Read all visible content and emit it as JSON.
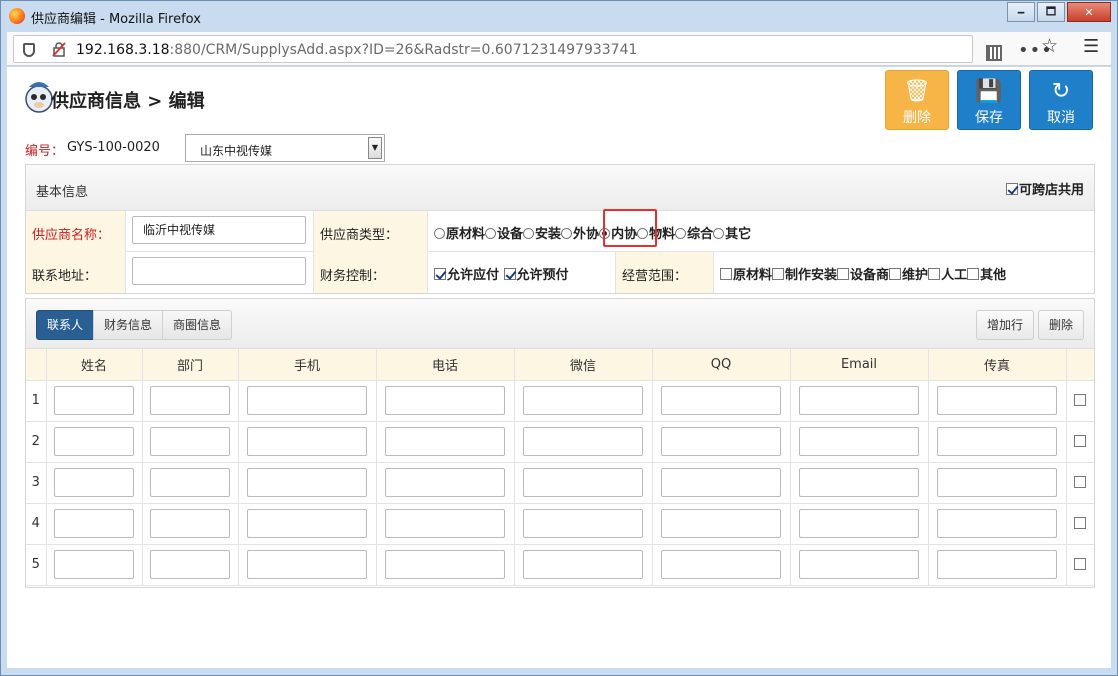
{
  "window": {
    "title": "供应商编辑 - Mozilla Firefox",
    "minimize_label": "🗕",
    "maximize_label": "🗖",
    "close_label": "✕"
  },
  "browser": {
    "url_host": "192.168.3.18",
    "url_rest": ":880/CRM/SupplysAdd.aspx?ID=26&Radstr=0.6071231497933741"
  },
  "page": {
    "title": "供应商信息 > 编辑",
    "actions": {
      "delete": "删除",
      "save": "保存",
      "cancel": "取消"
    },
    "code_label": "编号：",
    "code_value": "GYS-100-0020",
    "company_select": "山东中视传媒"
  },
  "basic_info": {
    "title": "基本信息",
    "cross_share_label": "可跨店共用",
    "cross_share_checked": true,
    "supplier_name_label": "供应商名称：",
    "supplier_name_value": "临沂中视传媒",
    "supplier_type_label": "供应商类型：",
    "supplier_types": [
      "原材料",
      "设备",
      "安装",
      "外协",
      "内协",
      "物料",
      "综合",
      "其它"
    ],
    "supplier_type_selected": "内协",
    "address_label": "联系地址：",
    "address_value": "",
    "finance_label": "财务控制：",
    "finance_options": [
      "允许应付",
      "允许预付"
    ],
    "scope_label": "经营范围：",
    "scope_options": [
      "原材料",
      "制作安装",
      "设备商",
      "维护",
      "人工",
      "其他"
    ]
  },
  "contacts": {
    "tabs": [
      "联系人",
      "财务信息",
      "商圈信息"
    ],
    "active_tab": "联系人",
    "add_row_label": "增加行",
    "delete_label": "删除",
    "columns": [
      "姓名",
      "部门",
      "手机",
      "电话",
      "微信",
      "QQ",
      "Email",
      "传真"
    ],
    "row_numbers": [
      "1",
      "2",
      "3",
      "4",
      "5"
    ]
  },
  "colors": {
    "accent_blue": "#1f7fc9",
    "delete_orange": "#f7b548",
    "label_bg": "#fdf6e3",
    "required_red": "#d01f1f",
    "highlight_red": "#e53030"
  }
}
